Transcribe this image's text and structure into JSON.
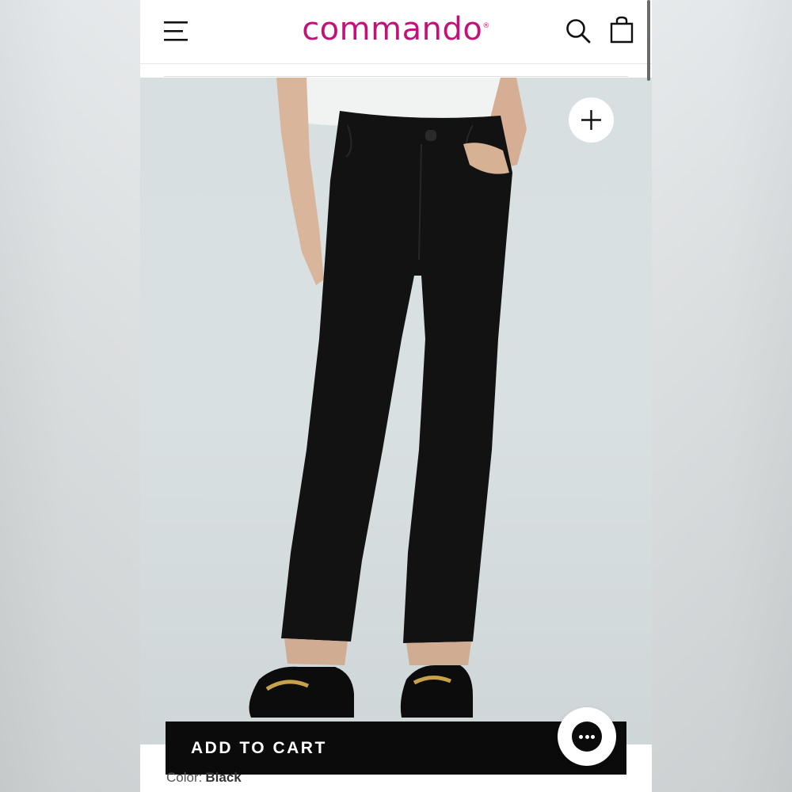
{
  "header": {
    "logo_text": "commando",
    "logo_mark": "®",
    "menu_icon": "hamburger-menu-icon",
    "search_icon": "search-icon",
    "bag_icon": "shopping-bag-icon",
    "brand_color": "#c2127a"
  },
  "product": {
    "image_subject": "model wearing black skinny jeans and black loafers",
    "zoom_icon": "plus-icon"
  },
  "cart": {
    "add_to_cart_label": "ADD TO CART",
    "chat_icon": "chat-bubble-icon"
  },
  "details": {
    "color_label": "Color:",
    "color_value": "Black"
  }
}
